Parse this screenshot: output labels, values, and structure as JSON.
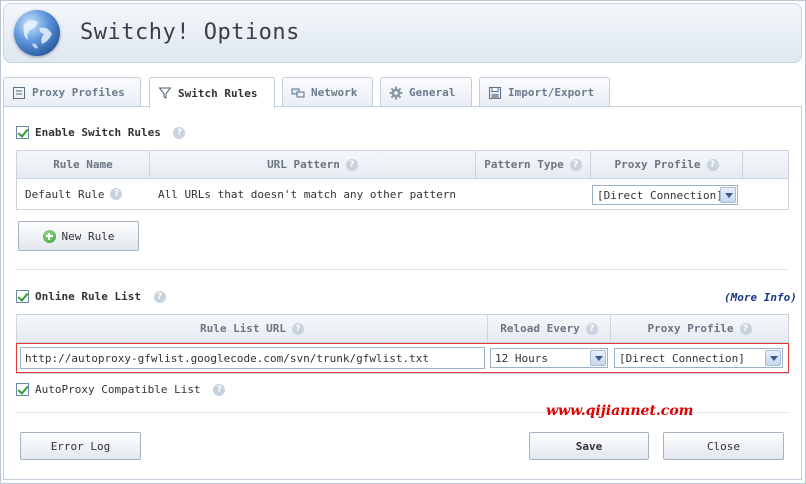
{
  "header": {
    "title": "Switchy! Options"
  },
  "tabs": [
    {
      "label": "Proxy Profiles",
      "icon": "proxy-profiles-icon",
      "active": false
    },
    {
      "label": "Switch Rules",
      "icon": "funnel-icon",
      "active": true
    },
    {
      "label": "Network",
      "icon": "network-icon",
      "active": false
    },
    {
      "label": "General",
      "icon": "gear-icon",
      "active": false
    },
    {
      "label": "Import/Export",
      "icon": "floppy-icon",
      "active": false
    }
  ],
  "switch_rules": {
    "enable_label": "Enable Switch Rules",
    "enabled": true,
    "columns": [
      "Rule Name",
      "URL Pattern",
      "Pattern Type",
      "Proxy Profile"
    ],
    "rows": [
      {
        "name": "Default Rule",
        "pattern": "All URLs that doesn't match any other pattern",
        "type": "",
        "profile": "[Direct Connection]"
      }
    ],
    "new_rule_label": "New Rule"
  },
  "online_rule_list": {
    "enable_label": "Online Rule List",
    "enabled": true,
    "more_info": "(More Info)",
    "columns": [
      "Rule List URL",
      "Reload Every",
      "Proxy Profile"
    ],
    "url": "http://autoproxy-gfwlist.googlecode.com/svn/trunk/gfwlist.txt",
    "reload": "12 Hours",
    "profile": "[Direct Connection]",
    "autoproxy_label": "AutoProxy Compatible List",
    "autoproxy_checked": true
  },
  "footer": {
    "error_log_label": "Error Log",
    "save_label": "Save",
    "close_label": "Close"
  },
  "watermark": "www.qijiannet.com",
  "colors": {
    "accent": "#3a5a8a",
    "highlight_border": "#e03a3a",
    "watermark": "#e00000"
  }
}
